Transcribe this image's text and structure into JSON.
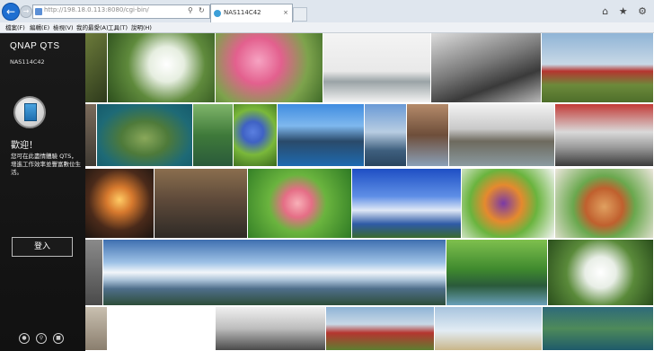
{
  "browser": {
    "address": "http://198.18.0.113:8080/cgi-bin/",
    "tab_title": "NAS114C42",
    "tab_close": "×",
    "window_icons": "⌂ ★ ⚙",
    "menu": [
      "檔案(F)",
      "編輯(E)",
      "檢視(V)",
      "我的最愛(A)",
      "工具(T)",
      "說明(H)"
    ]
  },
  "sidebar": {
    "brand": "QNAP QTS",
    "device_name": "NAS114C42",
    "welcome": "歡迎！",
    "description": "您可在此盡情體驗 QTS，增進工作效率並豐富數位生活。",
    "login_label": "登入",
    "icons": [
      "mobile-app-icon",
      "search-icon",
      "store-icon"
    ],
    "menu_toggle": "≡"
  },
  "photos": [
    {
      "name": "photo-tree-branch",
      "bg": "linear-gradient(135deg,#6b7a3a,#2e3a1c)"
    },
    {
      "name": "photo-white-cyclamen",
      "bg": "radial-gradient(circle at 55% 45%,#ffffff 0%,#e6eee0 25%,#5f8a3c 55%,#2c4e1c 100%)"
    },
    {
      "name": "photo-pink-blossoms",
      "bg": "radial-gradient(circle at 40% 40%,#f6a3c2 0%,#e3608e 30%,#7da34c 65%,#3f6a28 100%)"
    },
    {
      "name": "photo-misty-pier",
      "bg": "linear-gradient(180deg,#f4f4f4 0%,#e9e9e9 55%,#9aa3a6 70%,#f3f3f3 100%)"
    },
    {
      "name": "photo-bw-seashore",
      "bg": "linear-gradient(160deg,#dcdcdc 0%,#7a7a7a 45%,#3a3a3a 70%,#b9b9b9 100%)"
    },
    {
      "name": "photo-red-tractor",
      "bg": "linear-gradient(180deg,#8fb4d6 0%,#c8d8e6 45%,#b5352f 55%,#6c8a3b 75%,#4e6e2a 100%)"
    },
    {
      "name": "photo-strip-left",
      "bg": "linear-gradient(180deg,#7a6a5a,#3f3a33)"
    },
    {
      "name": "photo-aerial-heart-island",
      "bg": "radial-gradient(ellipse at 50% 55%,#8aa85a 0%,#4e7a3a 35%,#1e6a76 70%,#155a6c 100%)"
    },
    {
      "name": "photo-green-canal",
      "bg": "linear-gradient(180deg,#7fb56a 0%,#3f7a3a 50%,#2a5a3a 100%)"
    },
    {
      "name": "photo-blue-flowers",
      "bg": "radial-gradient(circle at 45% 45%,#5a7fe0 0%,#3f62c4 25%,#7ab83a 55%,#3a6a1e 100%)"
    },
    {
      "name": "photo-water-bungalows",
      "bg": "linear-gradient(180deg,#3f8ce0 0%,#7fb8ee 35%,#2a4a6a 60%,#1e6ab0 100%)"
    },
    {
      "name": "photo-harbor-boats",
      "bg": "linear-gradient(180deg,#6a9ad6 0%,#b8cde2 45%,#3e5f7e 75%,#2a4560 100%)"
    },
    {
      "name": "photo-rocky-channel",
      "bg": "linear-gradient(180deg,#b48a6a 0%,#6e4e3a 50%,#8aa0b8 100%)"
    },
    {
      "name": "photo-canal-warehouses",
      "bg": "linear-gradient(180deg,#f2f2f2 0%,#c9c9c9 40%,#6e6a5e 60%,#8a9aa0 100%)"
    },
    {
      "name": "photo-race-car",
      "bg": "linear-gradient(180deg,#c23a36 0%,#d9d9d9 45%,#9a9a9a 70%,#3a3a3a 100%)"
    },
    {
      "name": "photo-carousel-night",
      "bg": "radial-gradient(circle at 50% 45%,#ffcc66 0%,#d87a2e 25%,#4a2a1a 60%,#1a1410 100%)"
    },
    {
      "name": "photo-rainy-window",
      "bg": "linear-gradient(180deg,#8a6e4e 0%,#5e4a3a 45%,#2e2a26 100%)"
    },
    {
      "name": "photo-pink-camellia",
      "bg": "radial-gradient(circle at 48% 50%,#f8b0b8 0%,#e56e86 22%,#6ab43e 45%,#2e7a24 100%)"
    },
    {
      "name": "photo-blue-sky-cliff",
      "bg": "linear-gradient(180deg,#1e4fc4 0%,#5f8fe6 40%,#dfe8f6 60%,#2e5aa6 80%,#3a6a2e 100%)"
    },
    {
      "name": "photo-vegetables",
      "bg": "radial-gradient(circle at 45% 50%,#7a3aa6 0%,#e58a2e 30%,#6ab43e 55%,#f4f4f4 100%)"
    },
    {
      "name": "photo-food-plate",
      "bg": "radial-gradient(circle at 50% 55%,#e0a060 0%,#c0602e 30%,#6aa84e 50%,#ece6dc 100%)"
    },
    {
      "name": "photo-strip-left-2",
      "bg": "linear-gradient(180deg,#8a8a8a,#4a4a4a)"
    },
    {
      "name": "photo-coast-panorama",
      "bg": "linear-gradient(180deg,#3e6fb0 0%,#9ec2e6 35%,#f2f6fa 50%,#a8c0d6 62%,#4e6e8a 75%,#2e4e3a 100%)"
    },
    {
      "name": "photo-forest-lake",
      "bg": "linear-gradient(180deg,#7fc04e 0%,#3f8a2e 45%,#2a5a3a 70%,#6aa0b8 100%)"
    },
    {
      "name": "photo-cyclamen-2",
      "bg": "radial-gradient(circle at 50% 50%,#ffffff 0%,#e8eee6 25%,#5a8a3a 55%,#2a4e1c 100%)"
    },
    {
      "name": "photo-strip-left-3",
      "bg": "linear-gradient(180deg,#c9c0b0,#8a7e6e)"
    },
    {
      "name": "photo-blank-white",
      "bg": "#ffffff"
    },
    {
      "name": "photo-bw-shore-2",
      "bg": "linear-gradient(180deg,#f0f0f0 0%,#bdbdbd 50%,#4a4a4a 100%)"
    },
    {
      "name": "photo-tractor-2",
      "bg": "linear-gradient(180deg,#8fb4d6 0%,#c8d8e6 40%,#b5352f 60%,#5e7e30 100%)"
    },
    {
      "name": "photo-power-lines",
      "bg": "linear-gradient(180deg,#a8c4de 0%,#e2ecf4 55%,#c9b68a 100%)"
    },
    {
      "name": "photo-aerial-2",
      "bg": "linear-gradient(180deg,#2e6a7a 0%,#4e8a5a 50%,#1e5a6a 100%)"
    }
  ]
}
